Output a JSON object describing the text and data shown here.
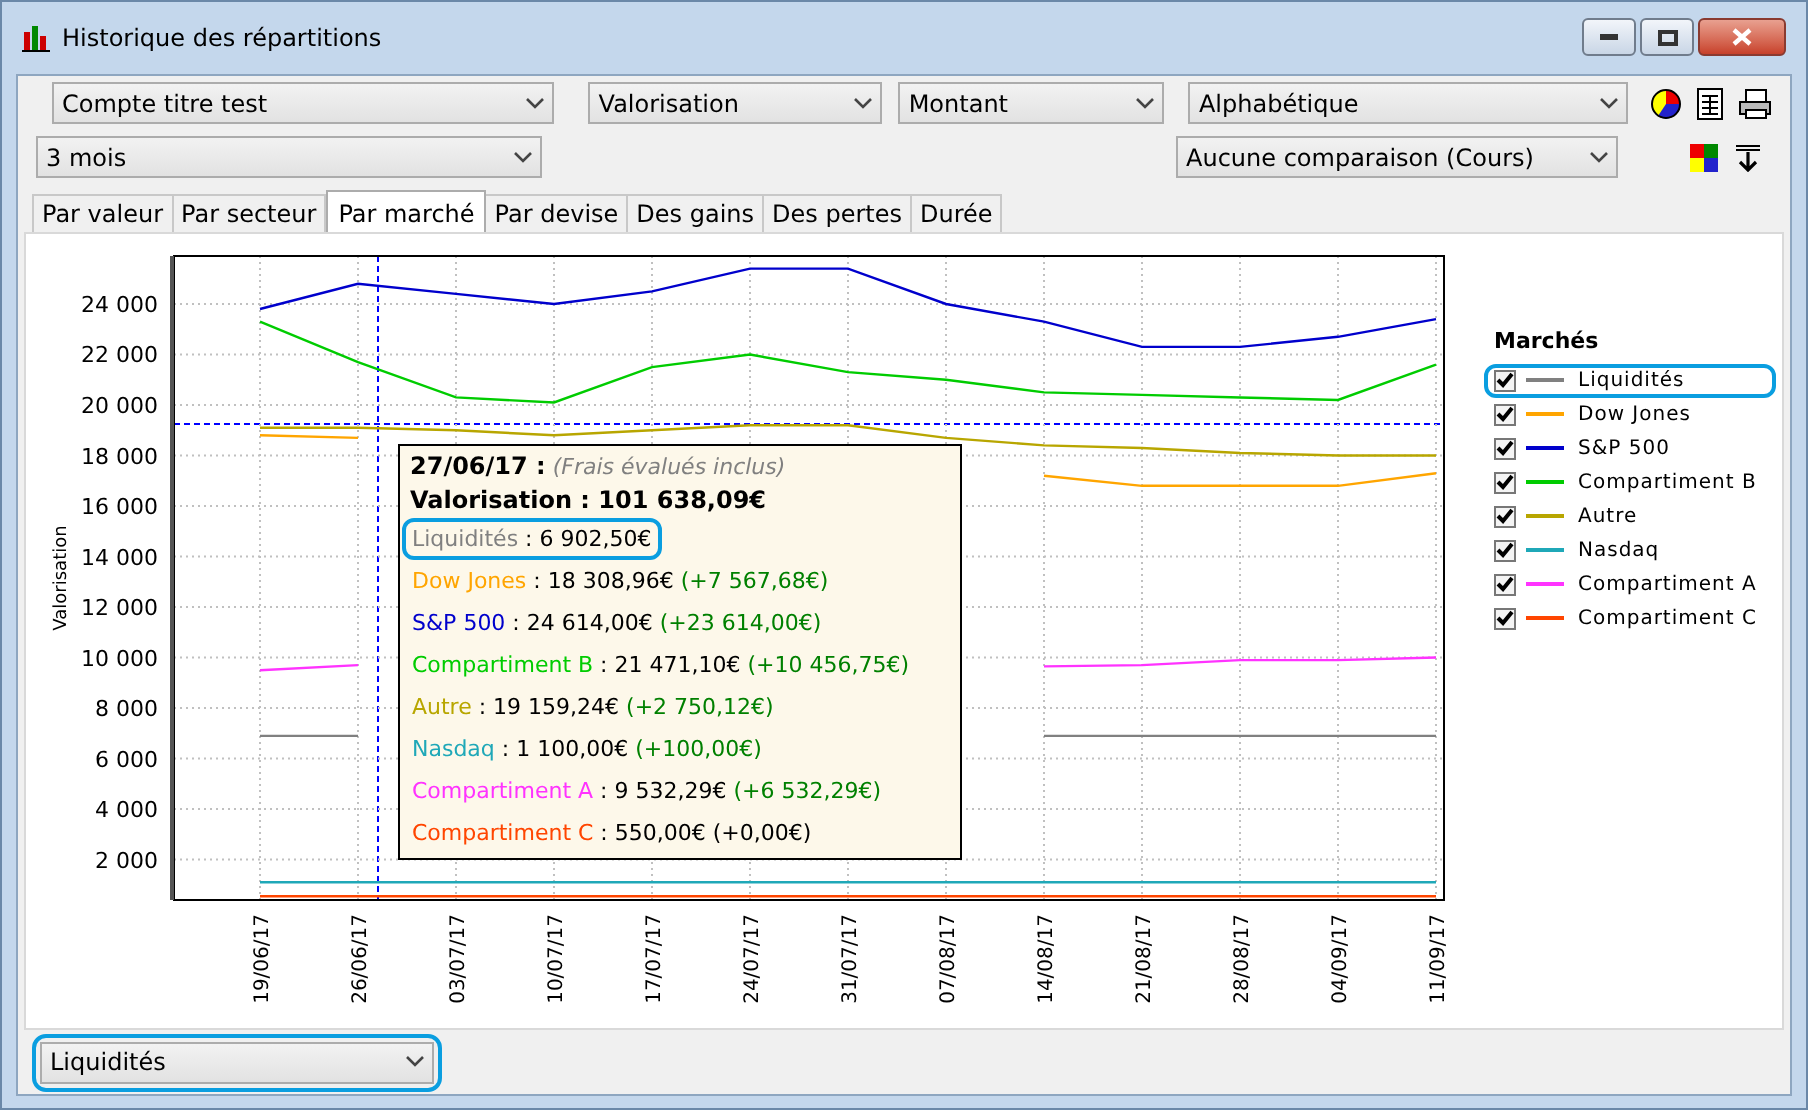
{
  "window": {
    "title": "Historique des répartitions"
  },
  "toolbar": {
    "row_1": [
      {
        "value": "Compte titre test"
      },
      {
        "value": "Valorisation"
      },
      {
        "value": "Montant"
      },
      {
        "value": "Alphabétique"
      }
    ],
    "row_2": [
      {
        "value": "3 mois"
      },
      {
        "value": "Aucune comparaison (Cours)"
      }
    ]
  },
  "tabs": [
    {
      "label": "Par valeur",
      "selected": false
    },
    {
      "label": "Par secteur",
      "selected": false
    },
    {
      "label": "Par marché",
      "selected": true
    },
    {
      "label": "Par devise",
      "selected": false
    },
    {
      "label": "Des gains",
      "selected": false
    },
    {
      "label": "Des pertes",
      "selected": false
    },
    {
      "label": "Durée",
      "selected": false
    }
  ],
  "chart": {
    "chart_data": {
      "type": "line",
      "ylabel": "Valorisation",
      "grid": true,
      "categories": [
        "19/06/17",
        "26/06/17",
        "03/07/17",
        "10/07/17",
        "17/07/17",
        "24/07/17",
        "31/07/17",
        "07/08/17",
        "14/08/17",
        "21/08/17",
        "28/08/17",
        "04/09/17",
        "11/09/17"
      ],
      "ylim": [
        400,
        25900
      ],
      "yticks": [
        {
          "value": 2000,
          "label": "2 000"
        },
        {
          "value": 4000,
          "label": "4 000"
        },
        {
          "value": 6000,
          "label": "6 000"
        },
        {
          "value": 8000,
          "label": "8 000"
        },
        {
          "value": 10000,
          "label": "10 000"
        },
        {
          "value": 12000,
          "label": "12 000"
        },
        {
          "value": 14000,
          "label": "14 000"
        },
        {
          "value": 16000,
          "label": "16 000"
        },
        {
          "value": 18000,
          "label": "18 000"
        },
        {
          "value": 20000,
          "label": "20 000"
        },
        {
          "value": 22000,
          "label": "22 000"
        },
        {
          "value": 24000,
          "label": "24 000"
        }
      ],
      "series": [
        {
          "name": "Liquidités",
          "color": "#808080",
          "values": [
            6900,
            6900,
            null,
            null,
            null,
            null,
            null,
            null,
            6900,
            6900,
            6900,
            6900,
            6900
          ]
        },
        {
          "name": "Dow Jones",
          "color": "#ffa500",
          "values": [
            18800,
            18700,
            null,
            null,
            null,
            null,
            null,
            null,
            17200,
            16800,
            16800,
            16800,
            17300
          ]
        },
        {
          "name": "S&P 500",
          "color": "#0000cc",
          "values": [
            23800,
            24800,
            24400,
            24000,
            24500,
            25400,
            25400,
            24000,
            23300,
            22300,
            22300,
            22700,
            23400
          ]
        },
        {
          "name": "Compartiment B",
          "color": "#00cc00",
          "values": [
            23300,
            21700,
            20300,
            20100,
            21500,
            22000,
            21300,
            21000,
            20500,
            20400,
            20300,
            20200,
            21600
          ]
        },
        {
          "name": "Autre",
          "color": "#b8a600",
          "values": [
            19100,
            19100,
            19000,
            18800,
            19000,
            19200,
            19200,
            18700,
            18400,
            18300,
            18100,
            18000,
            18000
          ]
        },
        {
          "name": "Nasdaq",
          "color": "#1fa8b8",
          "values": [
            1100,
            1100,
            1100,
            1100,
            1100,
            1100,
            1100,
            1100,
            1100,
            1100,
            1100,
            1100,
            1100
          ]
        },
        {
          "name": "Compartiment A",
          "color": "#ff33ff",
          "values": [
            9500,
            9700,
            null,
            null,
            null,
            null,
            null,
            null,
            9650,
            9700,
            9900,
            9900,
            10000
          ]
        },
        {
          "name": "Compartiment C",
          "color": "#ff4500",
          "values": [
            550,
            550,
            550,
            550,
            550,
            550,
            550,
            550,
            550,
            550,
            550,
            550,
            550
          ]
        }
      ]
    },
    "tooltip": {
      "date": "27/06/17 :",
      "note": "(Frais évalués inclus)",
      "total": "Valorisation : 101 638,09€",
      "lines": [
        {
          "name": "Liquidités",
          "color": "#808080",
          "value": " : 6 902,50€",
          "highlighted": true
        },
        {
          "name": "Dow Jones",
          "color": "#ffa500",
          "value": " : 18 308,96€",
          "change": "(+7 567,68€)",
          "kind": "gain",
          "highlighted": false
        },
        {
          "name": "S&P 500",
          "color": "#0000cc",
          "value": " : 24 614,00€",
          "change": "(+23 614,00€)",
          "kind": "gain",
          "highlighted": false
        },
        {
          "name": "Compartiment B",
          "color": "#00cc00",
          "value": " : 21 471,10€",
          "change": "(+10 456,75€)",
          "kind": "gain",
          "highlighted": false
        },
        {
          "name": "Autre",
          "color": "#b8a600",
          "value": " : 19 159,24€",
          "change": "(+2 750,12€)",
          "kind": "gain",
          "highlighted": false
        },
        {
          "name": "Nasdaq",
          "color": "#1fa8b8",
          "value": " : 1 100,00€",
          "change": "(+100,00€)",
          "kind": "gain",
          "highlighted": false
        },
        {
          "name": "Compartiment A",
          "color": "#ff33ff",
          "value": " : 9 532,29€",
          "change": "(+6 532,29€)",
          "kind": "gain",
          "highlighted": false
        },
        {
          "name": "Compartiment C",
          "color": "#ff4500",
          "value": " : 550,00€",
          "change": "(+0,00€)",
          "kind": "neutral",
          "highlighted": false
        }
      ]
    }
  },
  "legend": {
    "title": "Marchés",
    "items": [
      {
        "checked": true,
        "highlighted": true
      },
      {
        "checked": true,
        "highlighted": false
      },
      {
        "checked": true,
        "highlighted": false
      },
      {
        "checked": true,
        "highlighted": false
      },
      {
        "checked": true,
        "highlighted": false
      },
      {
        "checked": true,
        "highlighted": false
      },
      {
        "checked": true,
        "highlighted": false
      },
      {
        "checked": true,
        "highlighted": false
      }
    ]
  },
  "footer": {
    "dropdown": {
      "value": "Liquidités",
      "highlighted": true
    }
  }
}
